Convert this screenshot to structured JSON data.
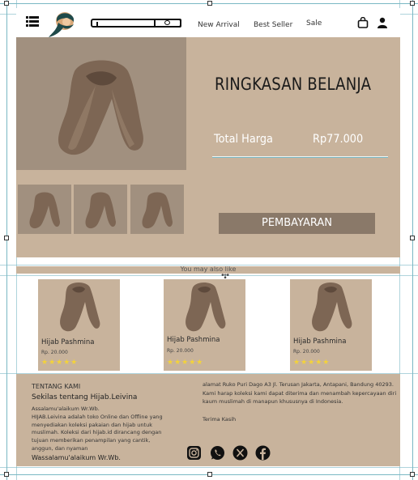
{
  "header": {
    "nav": [
      "New Arrival",
      "Best Seller",
      "Sale"
    ],
    "icons": [
      "menu-icon",
      "logo",
      "search-icon",
      "cart-icon",
      "user-icon"
    ]
  },
  "summary": {
    "title": "RINGKASAN BELANJA",
    "total_label": "Total Harga",
    "total_value": "Rp77.000",
    "pay_button": "PEMBAYARAN"
  },
  "recommend": {
    "heading": "You may also like",
    "products": [
      {
        "name": "Hijab Pashmina",
        "price": "Rp. 20.000",
        "rating": 5,
        "stars": "★★★★★"
      },
      {
        "name": "Hijab Pashmina",
        "price": "Rp. 20.000",
        "rating": 5,
        "stars": "★★★★★"
      },
      {
        "name": "Hijab Pashmina",
        "price": "Rp. 20.000",
        "rating": 5,
        "stars": "★★★★★"
      }
    ]
  },
  "footer": {
    "title": "TENTANG KAMI",
    "subtitle": "Sekilas tentang Hijab.Leivina",
    "greeting": "Assalamu'alaikum Wr.Wb.",
    "description": "HIJAB.Leivina adalah toko Online dan Offline yang menyediakan koleksi pakaian dan hijab untuk muslimah. Koleksi dari hijab.id dirancang dengan tujuan memberikan penampilan yang cantik, anggun, dan nyaman",
    "closing": "Wassalamu'alaikum Wr.Wb.",
    "address": "alamat Ruko Puri Dago A3 Jl. Terusan Jakarta, Antapani, Bandung 40293. Kami harap koleksi kami dapat diterima dan menambah kepercayaan diri kaum muslimah di manapun khususnya di Indonesia.",
    "thanks": "Terima Kasih",
    "social": [
      "instagram-icon",
      "whatsapp-icon",
      "x-icon",
      "facebook-icon"
    ]
  },
  "colors": {
    "brand_tan": "#c8b39c",
    "product_brown": "#8a7969",
    "star_yellow": "#f3d23a"
  }
}
